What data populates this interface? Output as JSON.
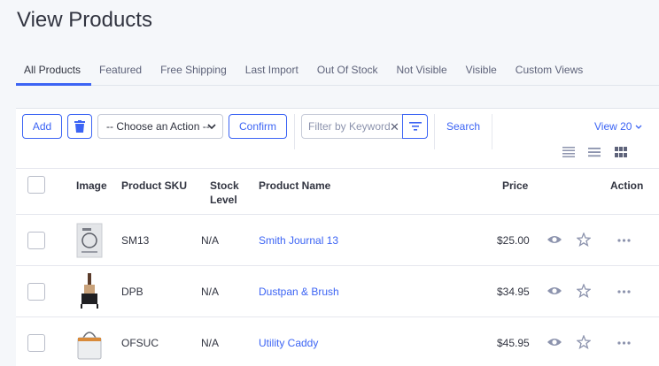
{
  "page": {
    "title": "View Products"
  },
  "tabs": [
    "All Products",
    "Featured",
    "Free Shipping",
    "Last Import",
    "Out Of Stock",
    "Not Visible",
    "Visible",
    "Custom Views"
  ],
  "toolbar": {
    "add_label": "Add",
    "action_select": "-- Choose an Action --",
    "confirm_label": "Confirm",
    "filter_placeholder": "Filter by Keyword",
    "search_label": "Search",
    "view_label": "View 20"
  },
  "table": {
    "headers": {
      "image": "Image",
      "sku": "Product SKU",
      "stock_line1": "Stock",
      "stock_line2": "Level",
      "name": "Product Name",
      "price": "Price",
      "action": "Action"
    },
    "rows": [
      {
        "sku": "SM13",
        "stock": "N/A",
        "name": "Smith Journal 13",
        "price": "$25.00",
        "thumb": "journal"
      },
      {
        "sku": "DPB",
        "stock": "N/A",
        "name": "Dustpan & Brush",
        "price": "$34.95",
        "thumb": "dustpan"
      },
      {
        "sku": "OFSUC",
        "stock": "N/A",
        "name": "Utility Caddy",
        "price": "$45.95",
        "thumb": "caddy"
      }
    ]
  },
  "colors": {
    "accent": "#3c64f4",
    "text": "#313440",
    "background": "#f5f7fa"
  }
}
